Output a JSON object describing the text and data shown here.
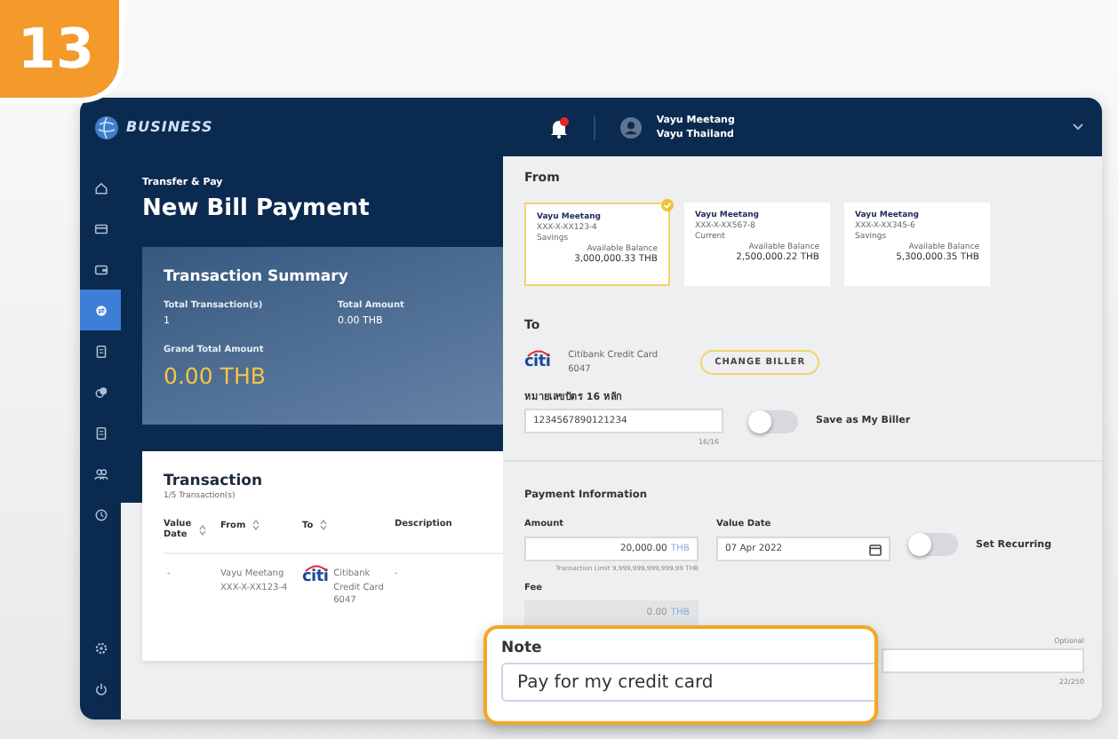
{
  "step_badge": "13",
  "header": {
    "logo_text": "BUSINESS",
    "notification": true,
    "user_name": "Vayu Meetang",
    "company": "Vayu Thailand"
  },
  "sidebar": {
    "items": [
      {
        "kind": "home",
        "selected": false
      },
      {
        "kind": "card",
        "selected": false
      },
      {
        "kind": "wallet",
        "selected": false
      },
      {
        "kind": "transfer",
        "selected": true
      },
      {
        "kind": "document",
        "selected": false
      },
      {
        "kind": "coins",
        "selected": false
      },
      {
        "kind": "document",
        "selected": false
      },
      {
        "kind": "users",
        "selected": false
      },
      {
        "kind": "clock",
        "selected": false
      }
    ],
    "bottom_items": [
      {
        "kind": "settings",
        "selected": false
      },
      {
        "kind": "power",
        "selected": false
      }
    ]
  },
  "breadcrumb": "Transfer & Pay",
  "title": "New Bill Payment",
  "summary": {
    "title": "Transaction Summary",
    "total_transactions_label": "Total Transaction(s)",
    "total_transactions": "1",
    "total_amount_label": "Total Amount",
    "total_amount": "0.00 THB",
    "grand_total_label": "Grand Total Amount",
    "grand_total": "0.00 THB"
  },
  "transactions": {
    "title": "Transaction",
    "count": "1/5 Transaction(s)",
    "columns": [
      "Value Date",
      "From",
      "To",
      "Description"
    ],
    "rows": [
      {
        "value_date": "-",
        "from": [
          "Vayu Meetang",
          "XXX-X-XX123-4"
        ],
        "to_logo": "citi",
        "to": [
          "Citibank",
          "Credit Card",
          "6047"
        ],
        "description": "-"
      }
    ]
  },
  "from": {
    "title": "From",
    "accounts": [
      {
        "name": "Vayu Meetang",
        "number": "XXX-X-XX123-4",
        "type": "Savings",
        "balance_label": "Available Balance",
        "balance": "3,000,000.33 THB",
        "selected": true
      },
      {
        "name": "Vayu Meetang",
        "number": "XXX-X-XX567-8",
        "type": "Current",
        "balance_label": "Available Balance",
        "balance": "2,500,000.22 THB",
        "selected": false
      },
      {
        "name": "Vayu Meetang",
        "number": "XXX-X-XX345-6",
        "type": "Savings",
        "balance_label": "Available Balance",
        "balance": "5,300,000.35 THB",
        "selected": false
      }
    ]
  },
  "to": {
    "title": "To",
    "biller_logo": "citi",
    "biller_name": "Citibank Credit Card",
    "biller_code": "6047",
    "change_button": "CHANGE BILLER",
    "ref_label": "หมายเลขบัตร 16 หลัก",
    "ref_value": "1234567890121234",
    "ref_counter": "16/16",
    "save_biller": {
      "label": "Save as My Biller",
      "on": false
    }
  },
  "payment": {
    "title": "Payment Information",
    "amount_label": "Amount",
    "amount": "20,000.00",
    "amount_unit": "THB",
    "limit": "Transaction Limit 9,999,999,999,999.99 THB",
    "value_date_label": "Value Date",
    "value_date": "07 Apr 2022",
    "recurring": {
      "label": "Set Recurring",
      "on": false
    },
    "fee_label": "Fee",
    "fee": "0.00",
    "fee_unit": "THB",
    "note_hint": "Optional",
    "note_counter": "22/250"
  },
  "note_callout": {
    "label": "Note",
    "value": "Pay for my credit card"
  }
}
